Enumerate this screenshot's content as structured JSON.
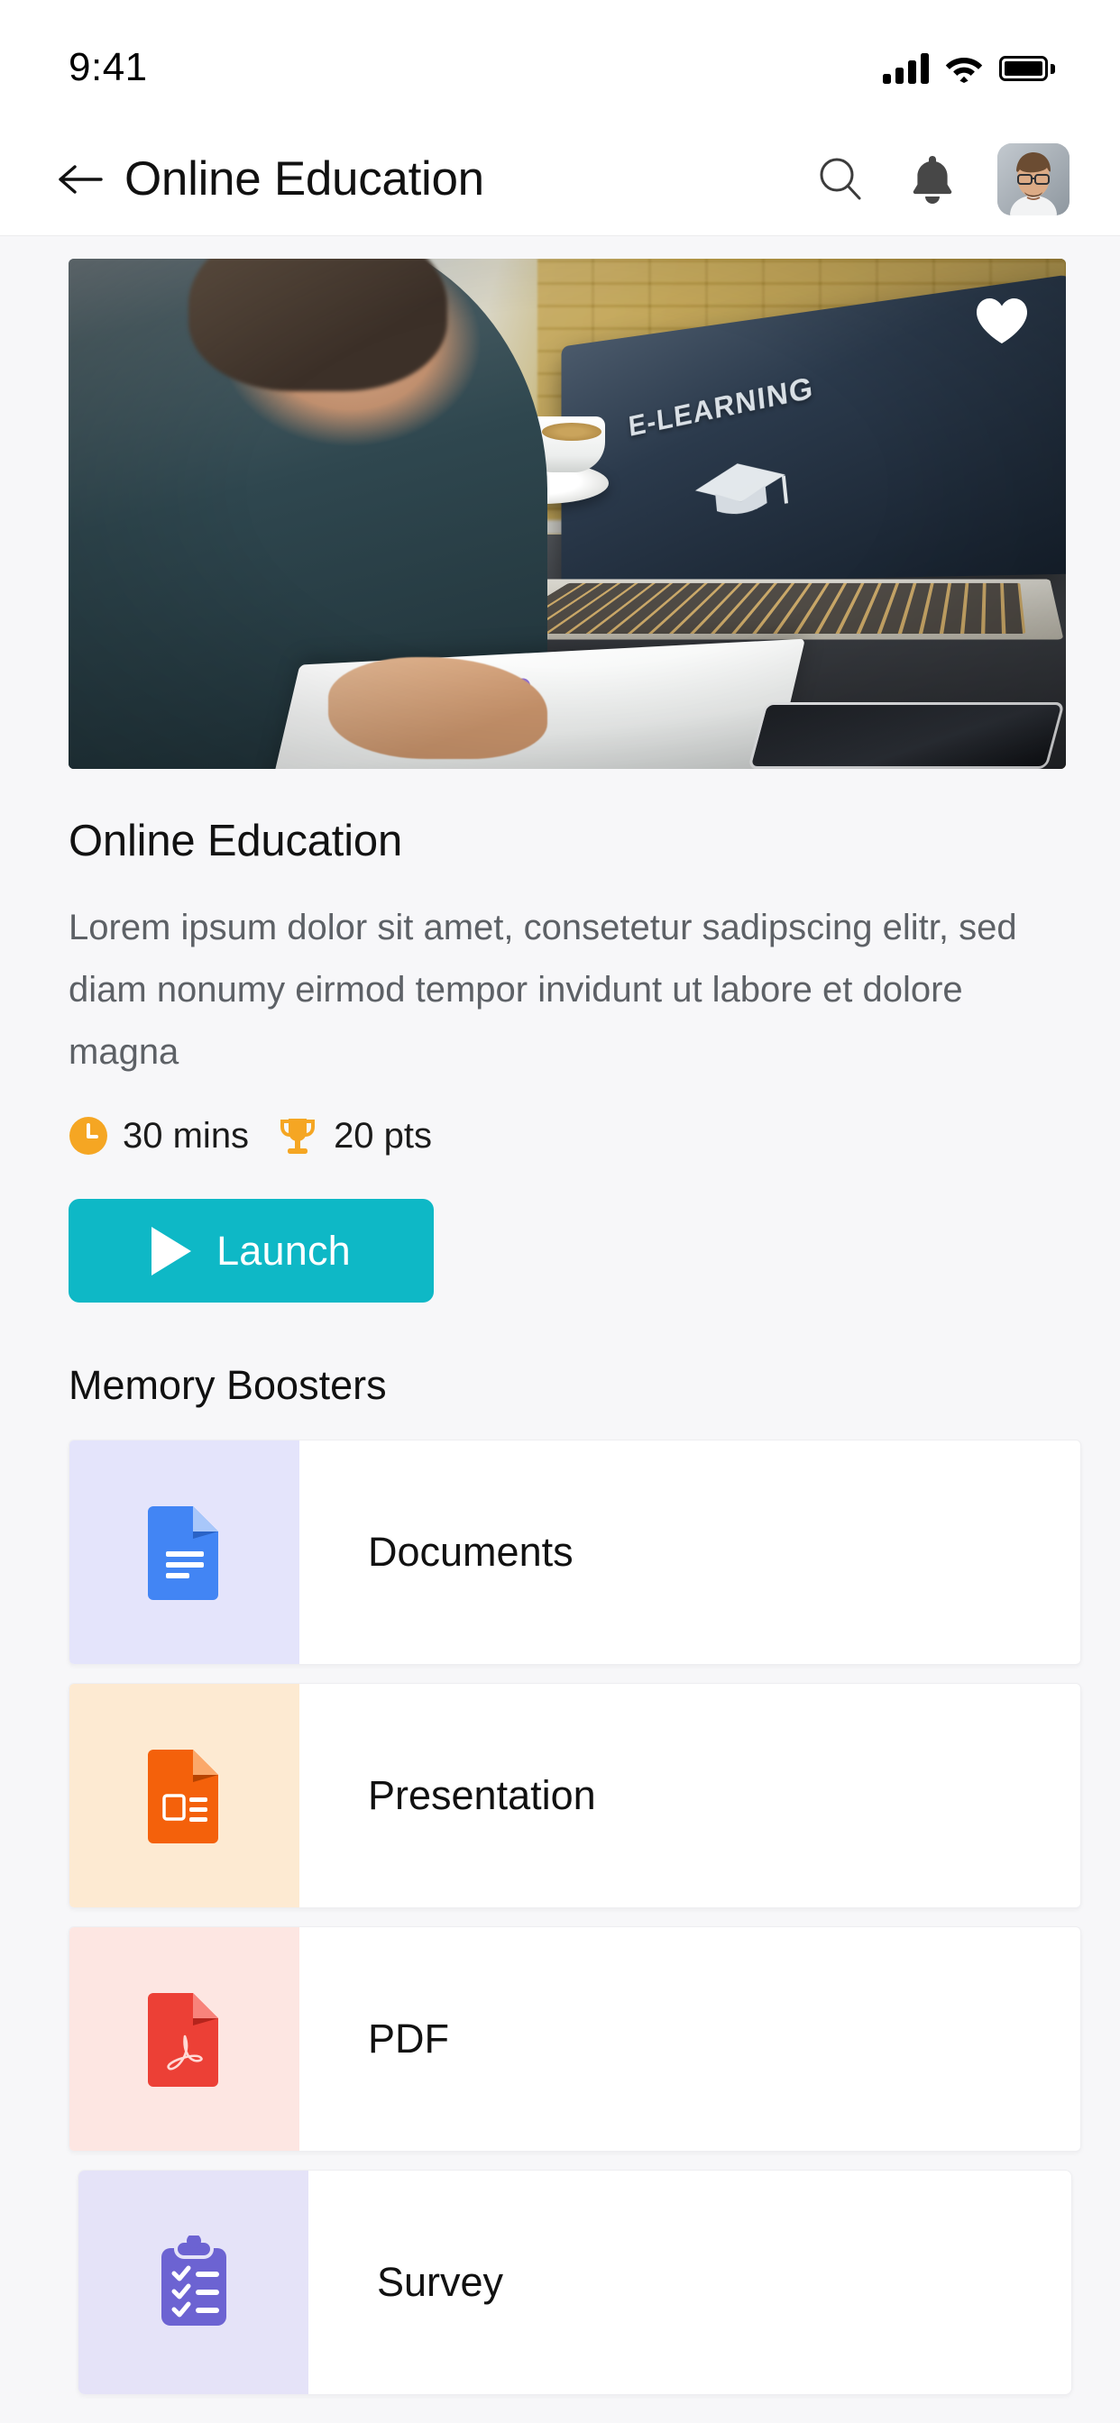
{
  "status_bar": {
    "time": "9:41",
    "icons": [
      "cellular-signal-icon",
      "wifi-icon",
      "battery-icon"
    ]
  },
  "app_bar": {
    "back_icon": "back-arrow-icon",
    "title": "Online Education",
    "search_icon": "search-icon",
    "notification_icon": "bell-icon",
    "avatar_alt": "user-avatar"
  },
  "hero": {
    "favorite_icon": "heart-icon",
    "favorite_state": "filled",
    "laptop_screen_text": "E-LEARNING",
    "laptop_screen_icon": "graduation-cap-icon",
    "photo_alt": "woman studying at laptop in cafe"
  },
  "course": {
    "title": "Online Education",
    "description": "Lorem ipsum dolor sit amet, consetetur sadipscing elitr, sed diam nonumy eirmod tempor invidunt ut labore et dolore magna",
    "meta": [
      {
        "icon": "clock-icon",
        "text": "30 mins",
        "color": "#f5a623"
      },
      {
        "icon": "trophy-icon",
        "text": "20 pts",
        "color": "#f5a623"
      }
    ],
    "launch_button": {
      "label": "Launch",
      "icon": "play-icon",
      "background": "#0eb8c6",
      "text_color": "#ffffff"
    }
  },
  "memory_boosters": {
    "section_title": "Memory Boosters",
    "items": [
      {
        "label": "Documents",
        "icon": "google-docs-icon",
        "thumb_background": "#e4e4fb",
        "icon_color": "#4285f4",
        "inset": false
      },
      {
        "label": "Presentation",
        "icon": "google-slides-icon",
        "thumb_background": "#fdead2",
        "icon_color": "#f4610b",
        "inset": false
      },
      {
        "label": "PDF",
        "icon": "pdf-icon",
        "thumb_background": "#fde6e2",
        "icon_color": "#ec4036",
        "inset": false
      },
      {
        "label": "Survey",
        "icon": "clipboard-checklist-icon",
        "thumb_background": "#e5e3f8",
        "icon_color": "#6c63d2",
        "inset": true
      }
    ]
  },
  "theme": {
    "page_background": "#f7f7f9",
    "surface": "#ffffff",
    "accent": "#0eb8c6",
    "text_primary": "#111111",
    "text_secondary": "#5d6166",
    "meta_accent": "#f5a623"
  }
}
